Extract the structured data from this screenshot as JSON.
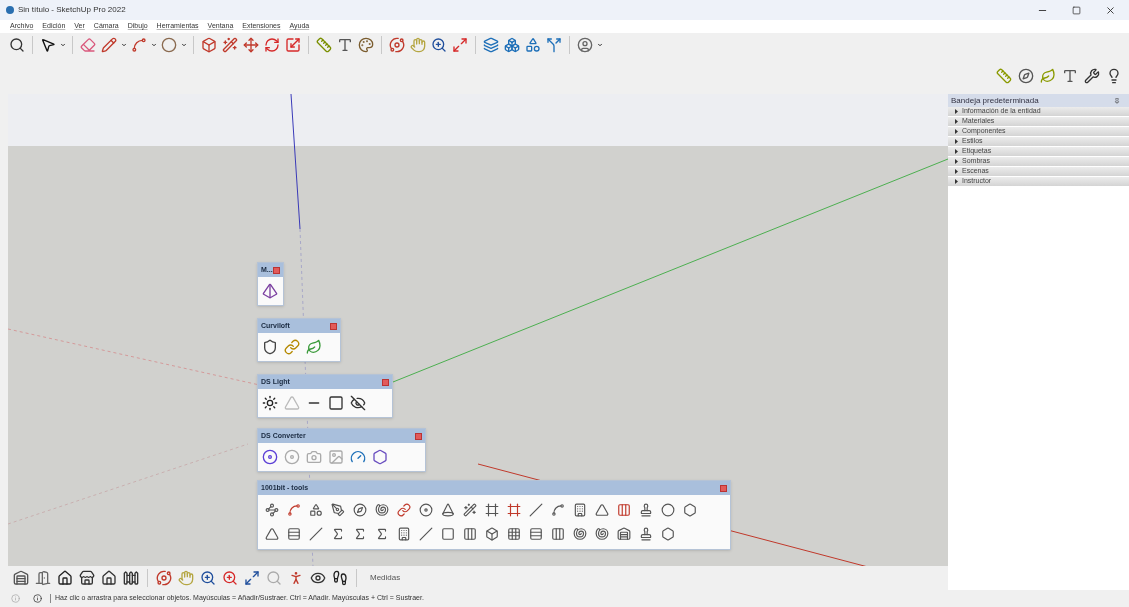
{
  "window": {
    "title": "Sin título - SketchUp Pro 2022"
  },
  "menu": [
    "Archivo",
    "Edición",
    "Ver",
    "Cámara",
    "Dibujo",
    "Herramientas",
    "Ventana",
    "Extensiones",
    "Ayuda"
  ],
  "tray": {
    "title": "Bandeja predeterminada",
    "panels": [
      {
        "label": "Información de la entidad",
        "expanded": false
      },
      {
        "label": "Materiales",
        "expanded": false
      },
      {
        "label": "Componentes",
        "expanded": false
      },
      {
        "label": "Estilos",
        "expanded": false
      },
      {
        "label": "Etiquetas",
        "expanded": false
      },
      {
        "label": "Sombras",
        "expanded": false
      },
      {
        "label": "Escenas",
        "expanded": false
      },
      {
        "label": "Instructor",
        "expanded": false
      }
    ]
  },
  "floating_toolbars": [
    {
      "title": "M..."
    },
    {
      "title": "Curviloft"
    },
    {
      "title": "DS Light"
    },
    {
      "title": "DS Converter"
    },
    {
      "title": "1001bit - tools"
    }
  ],
  "measurements": {
    "label": "Medidas"
  },
  "status_bar": {
    "text": "Haz clic o arrastra para seleccionar objetos. Mayúsculas = Añadir/Sustraer. Ctrl = Añadir. Mayúsculas + Ctrl = Sustraer."
  }
}
